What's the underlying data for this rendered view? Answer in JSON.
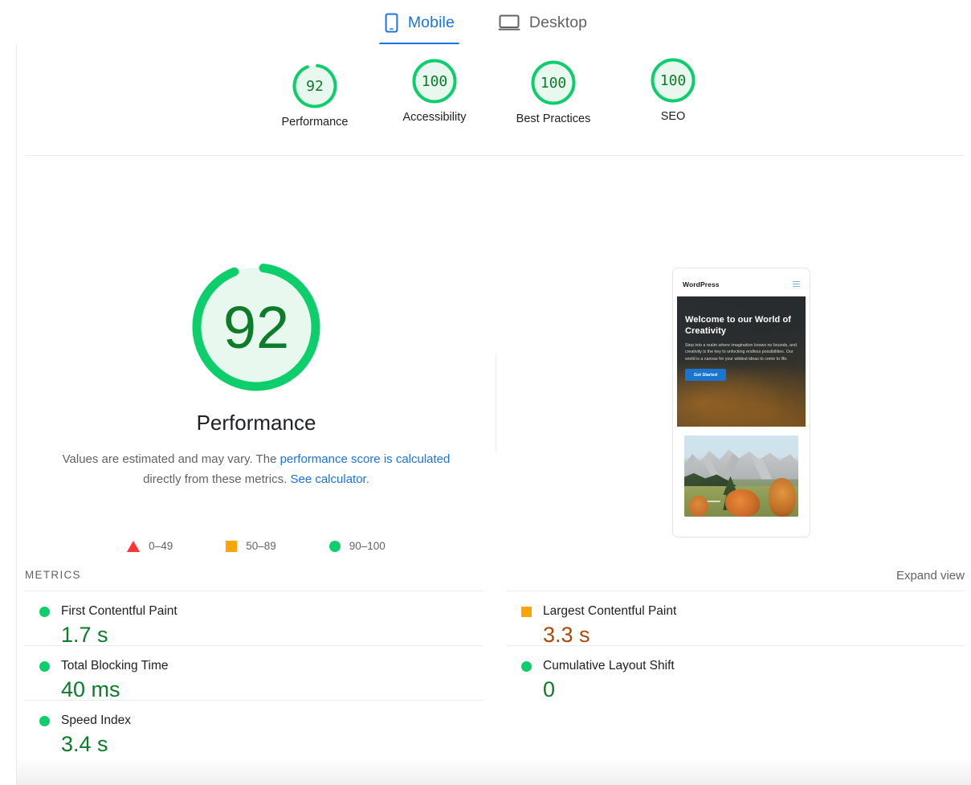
{
  "tabs": [
    {
      "label": "Mobile",
      "icon": "mobile-phone-icon",
      "active": true
    },
    {
      "label": "Desktop",
      "icon": "desktop-monitor-icon",
      "active": false
    }
  ],
  "category_scores": [
    {
      "label": "Performance",
      "score": "92",
      "value": 92,
      "color": "#0cce6b"
    },
    {
      "label": "Accessibility",
      "score": "100",
      "value": 100,
      "color": "#0cce6b"
    },
    {
      "label": "Best Practices",
      "score": "100",
      "value": 100,
      "color": "#0cce6b"
    },
    {
      "label": "SEO",
      "score": "100",
      "value": 100,
      "color": "#0cce6b"
    }
  ],
  "main_gauge": {
    "score": "92",
    "value": 92,
    "title": "Performance",
    "description_pre": "Values are estimated and may vary. The ",
    "description_link1": "performance score is calculated",
    "description_mid": " directly from these metrics. ",
    "description_link2": "See calculator.",
    "ring_color": "#0cce6b",
    "text_color": "#0b7c2a"
  },
  "legend": [
    {
      "shape": "triangle",
      "range": "0–49",
      "color": "#ff3333"
    },
    {
      "shape": "square",
      "range": "50–89",
      "color": "#ffa400"
    },
    {
      "shape": "circle",
      "range": "90–100",
      "color": "#0cce6b"
    }
  ],
  "metrics_section": {
    "title": "METRICS",
    "expand_label": "Expand view"
  },
  "metrics": {
    "left": [
      {
        "name": "First Contentful Paint",
        "value": "1.7 s",
        "status": "pass",
        "value_color": "#0b7c2a"
      },
      {
        "name": "Total Blocking Time",
        "value": "40 ms",
        "status": "pass",
        "value_color": "#0b7c2a"
      },
      {
        "name": "Speed Index",
        "value": "3.4 s",
        "status": "pass",
        "value_color": "#0b7c2a"
      }
    ],
    "right": [
      {
        "name": "Largest Contentful Paint",
        "value": "3.3 s",
        "status": "average",
        "value_color": "#b1460a"
      },
      {
        "name": "Cumulative Layout Shift",
        "value": "0",
        "status": "pass",
        "value_color": "#0b7c2a"
      }
    ]
  },
  "thumbnail": {
    "brand": "WordPress",
    "menu_icon": "hamburger-menu-icon",
    "hero_heading": "Welcome to our World of Creativity",
    "hero_paragraph": "Step into a realm where imagination knows no bounds, and creativity is the key to unlocking endless possibilities. Our world is a canvas for your wildest ideas to come to life.",
    "hero_button": "Get Started",
    "photo_alt": "autumn-mountain-landscape"
  }
}
